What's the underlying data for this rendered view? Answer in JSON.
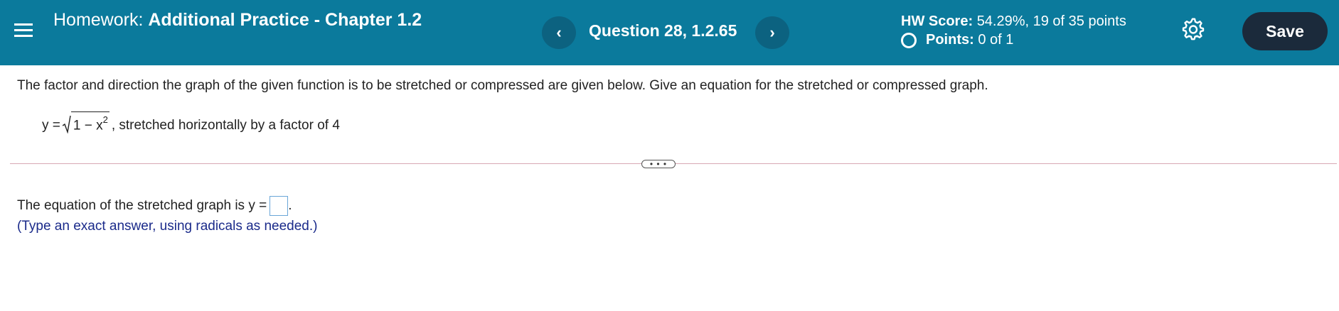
{
  "header": {
    "title_label": "Homework:",
    "title_name": "Additional Practice - Chapter 1.2",
    "prev_icon": "‹",
    "next_icon": "›",
    "question": "Question 28, 1.2.65",
    "hw_score_label": "HW Score:",
    "hw_score_value": "54.29%, 19 of 35 points",
    "points_label": "Points:",
    "points_value": "0 of 1",
    "save_label": "Save",
    "background": "#0b7a9c",
    "save_color": "#1b2a3b"
  },
  "problem": {
    "instructions": "The factor and direction the graph of the given function is to be stretched or compressed are given below. Give an equation for the stretched or compressed graph.",
    "eq_prefix": "y =",
    "radicand_base": "1 − x",
    "radicand_exp": "2",
    "eq_suffix": ", stretched horizontally by a factor of 4"
  },
  "divider": {
    "more_label": "• • •"
  },
  "answer": {
    "prompt": "The equation of the stretched graph is y =",
    "period": ".",
    "hint": "(Type an exact answer, using radicals as needed.)",
    "hint_color": "#1a2a8a"
  },
  "icons": [
    "menu-icon",
    "chevron-left-icon",
    "chevron-right-icon",
    "gear-icon",
    "circle-icon"
  ]
}
